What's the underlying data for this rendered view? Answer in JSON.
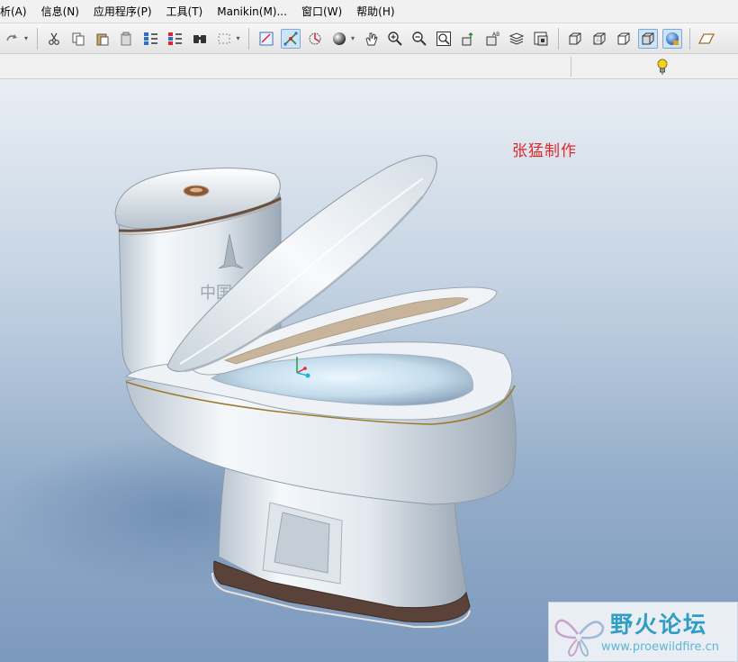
{
  "menu": {
    "items": [
      "析(A)",
      "信息(N)",
      "应用程序(P)",
      "工具(T)",
      "Manikin(M)...",
      "窗口(W)",
      "帮助(H)"
    ]
  },
  "toolbar": {
    "icons": [
      "redo-icon",
      "cut-icon",
      "copy-icon",
      "paste-icon",
      "paste-special-icon",
      "regenerate-icon",
      "regenerate-manager-icon",
      "find-icon",
      "select-box-icon",
      "repaint-icon",
      "spin-center-icon",
      "orient-icon",
      "shading-icon",
      "pan-icon",
      "zoom-in-icon",
      "zoom-out-icon",
      "refit-icon",
      "view-manager-icon",
      "saved-views-icon",
      "layers-icon",
      "wireframe-icon",
      "hidden-line-icon",
      "no-hidden-icon",
      "shaded-edges-icon",
      "shaded-icon",
      "datum-plane-icon"
    ]
  },
  "viewport": {
    "author_text": "张猛制作",
    "model_text": "中国",
    "watermark_title": "野火论坛",
    "watermark_url": "www.proewildfire.cn"
  }
}
